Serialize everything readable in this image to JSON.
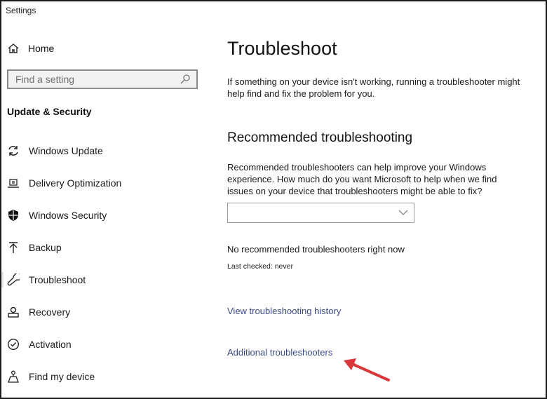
{
  "window": {
    "title": "Settings"
  },
  "sidebar": {
    "home_label": "Home",
    "search": {
      "placeholder": "Find a setting",
      "value": ""
    },
    "section_title": "Update & Security",
    "items": [
      {
        "label": "Windows Update",
        "icon": "sync-icon"
      },
      {
        "label": "Delivery Optimization",
        "icon": "delivery-optimization-icon"
      },
      {
        "label": "Windows Security",
        "icon": "shield-icon"
      },
      {
        "label": "Backup",
        "icon": "upload-arrow-icon"
      },
      {
        "label": "Troubleshoot",
        "icon": "wrench-icon",
        "selected": true
      },
      {
        "label": "Recovery",
        "icon": "recovery-icon"
      },
      {
        "label": "Activation",
        "icon": "check-circle-icon"
      },
      {
        "label": "Find my device",
        "icon": "person-location-icon"
      }
    ]
  },
  "main": {
    "title": "Troubleshoot",
    "intro": "If something on your device isn't working, running a troubleshooter might help find and fix the problem for you.",
    "recommended": {
      "heading": "Recommended troubleshooting",
      "description": "Recommended troubleshooters can help improve your Windows experience. How much do you want Microsoft to help when we find issues on your device that troubleshooters might be able to fix?",
      "dropdown_value": "",
      "status": "No recommended troubleshooters right now",
      "last_checked": "Last checked: never"
    },
    "links": {
      "history": "View troubleshooting history",
      "additional": "Additional troubleshooters"
    },
    "annotation": {
      "type": "arrow",
      "points_to": "Additional troubleshooters",
      "color": "#d9373a"
    }
  },
  "colors": {
    "link": "#3a4a86",
    "frame_border": "#1b1b1b",
    "search_bg": "#f2f2f2"
  }
}
